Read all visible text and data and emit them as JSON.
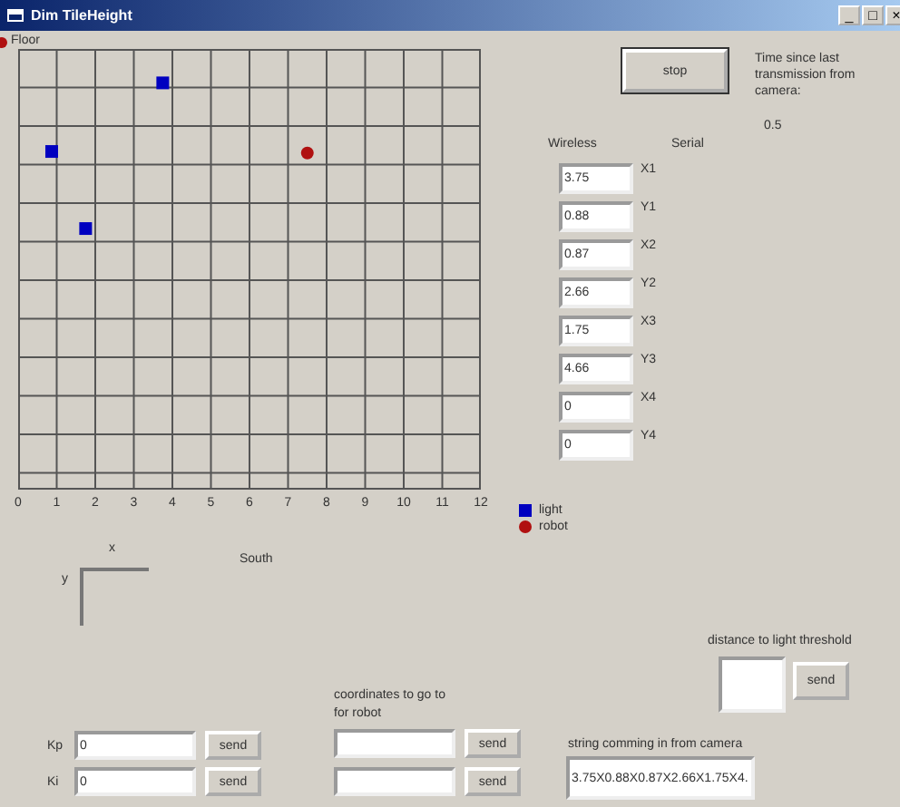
{
  "window": {
    "title": "Dim TileHeight",
    "controls": [
      "_",
      "□",
      "×"
    ]
  },
  "plot": {
    "title": "Floor",
    "axis_caption": "South",
    "x_tick_labels": [
      "0",
      "1",
      "2",
      "3",
      "4",
      "5",
      "6",
      "7",
      "8",
      "9",
      "10",
      "11",
      "12"
    ],
    "legend": [
      {
        "label": "light",
        "color": "#0000c0",
        "kind": "square"
      },
      {
        "label": "robot",
        "color": "#b01010",
        "kind": "circle"
      }
    ]
  },
  "axes_hint": {
    "x": "x",
    "y": "y"
  },
  "stop_button": "stop",
  "time_label": "Time since last transmission from camera:",
  "time_value": "0.5",
  "column_headings": [
    "Wireless",
    "Serial"
  ],
  "coordinates": [
    {
      "value": "3.75",
      "label": "X1"
    },
    {
      "value": "0.88",
      "label": "Y1"
    },
    {
      "value": "0.87",
      "label": "X2"
    },
    {
      "value": "2.66",
      "label": "Y2"
    },
    {
      "value": "1.75",
      "label": "X3"
    },
    {
      "value": "4.66",
      "label": "Y3"
    },
    {
      "value": "0",
      "label": "X4"
    },
    {
      "value": "0",
      "label": "Y4"
    }
  ],
  "threshold": {
    "label": "distance to light threshold",
    "button": "send"
  },
  "goto": {
    "label": "coordinates to go to for robot",
    "buttons": [
      "send",
      "send"
    ]
  },
  "gains": [
    {
      "label": "Kp",
      "value": "0",
      "button": "send"
    },
    {
      "label": "Ki",
      "value": "0",
      "button": "send"
    }
  ],
  "camera_string": {
    "label": "string comming in from camera",
    "value": "3.75X0.88X0.87X2.66X1.75X4."
  }
}
